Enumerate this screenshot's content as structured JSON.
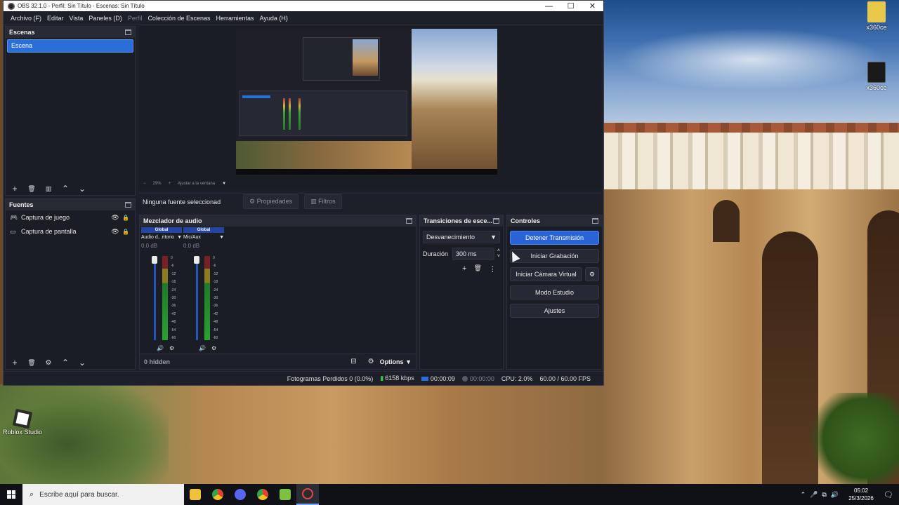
{
  "window": {
    "title": "OBS 32.1.0 - Perfil: Sin Título - Escenas: Sin Título",
    "controls": [
      "—",
      "☐",
      "✕"
    ]
  },
  "menu": [
    {
      "label": "Archivo (F)",
      "enabled": true
    },
    {
      "label": "Editar",
      "enabled": true
    },
    {
      "label": "Vista",
      "enabled": true
    },
    {
      "label": "Paneles (D)",
      "enabled": true
    },
    {
      "label": "Perfil",
      "enabled": false
    },
    {
      "label": "Colección de Escenas",
      "enabled": true
    },
    {
      "label": "Herramientas",
      "enabled": true
    },
    {
      "label": "Ayuda (H)",
      "enabled": true
    }
  ],
  "scenes": {
    "title": "Escenas",
    "items": [
      "Escena"
    ],
    "toolbar": [
      "+",
      "🗑",
      "▥",
      "⌃",
      "⌄"
    ]
  },
  "sources": {
    "title": "Fuentes",
    "items": [
      {
        "label": "Captura de juego",
        "icon": "gamepad-icon"
      },
      {
        "label": "Captura de pantalla",
        "icon": "monitor-icon"
      }
    ],
    "toolbar": [
      "+",
      "🗑",
      "⚙",
      "⌃",
      "⌄"
    ]
  },
  "preview": {
    "zoom_minus": "−",
    "zoom_value": "29%",
    "zoom_plus": "+",
    "fit_label": "Ajustar a la ventana"
  },
  "context": {
    "no_source": "Ninguna fuente seleccionad",
    "properties": "Propiedades",
    "filters": "Filtros"
  },
  "mixer": {
    "title": "Mezclador de audio",
    "channels": [
      {
        "badge": "Global",
        "name": "Audio d...ritorio",
        "db": "0.0 dB"
      },
      {
        "badge": "Global",
        "name": "Mic/Aux",
        "db": "0.0 dB"
      }
    ],
    "ticks": [
      "0",
      "-6",
      "-12",
      "-18",
      "-24",
      "-30",
      "-36",
      "-42",
      "-48",
      "-54",
      "-60"
    ],
    "hidden_label": "0 hidden",
    "options_label": "Options"
  },
  "transitions": {
    "title": "Transiciones de esce...",
    "selected": "Desvanecimiento",
    "duration_label": "Duración",
    "duration_value": "300 ms"
  },
  "controls": {
    "title": "Controles",
    "stop_stream": "Detener Transmisión",
    "start_recording": "Iniciar Grabación",
    "virtual_cam": "Iniciar Cámara Virtual",
    "studio_mode": "Modo Estudio",
    "settings": "Ajustes"
  },
  "status": {
    "dropped": "Fotogramas Perdidos 0 (0.0%)",
    "bitrate": "6158 kbps",
    "stream_time": "00:00:09",
    "rec_time": "00:00:00",
    "cpu": "CPU: 2.0%",
    "fps": "60.00 / 60.00 FPS"
  },
  "desktop": {
    "icons": [
      {
        "label": "x360ce",
        "color": "#e8c84a"
      },
      {
        "label": "x360ce",
        "color": "#1a1a1a"
      },
      {
        "label": "Roblox Studio",
        "color": "#2a2a2a"
      }
    ]
  },
  "taskbar": {
    "search_placeholder": "Escribe aquí para buscar.",
    "apps": [
      {
        "name": "file-explorer-icon",
        "color": "#f0c23a"
      },
      {
        "name": "chrome-icon",
        "color": "#e34133"
      },
      {
        "name": "discord-icon",
        "color": "#5865f2"
      },
      {
        "name": "chrome-alt-icon",
        "color": "#3ca04a"
      },
      {
        "name": "android-studio-icon",
        "color": "#7bc142"
      },
      {
        "name": "obs-icon",
        "color": "#2b2b2b"
      }
    ],
    "time": "05:02",
    "date": "25/3/2026",
    "tray": [
      "⌃",
      "🎤",
      "⧉",
      "🔊"
    ]
  }
}
